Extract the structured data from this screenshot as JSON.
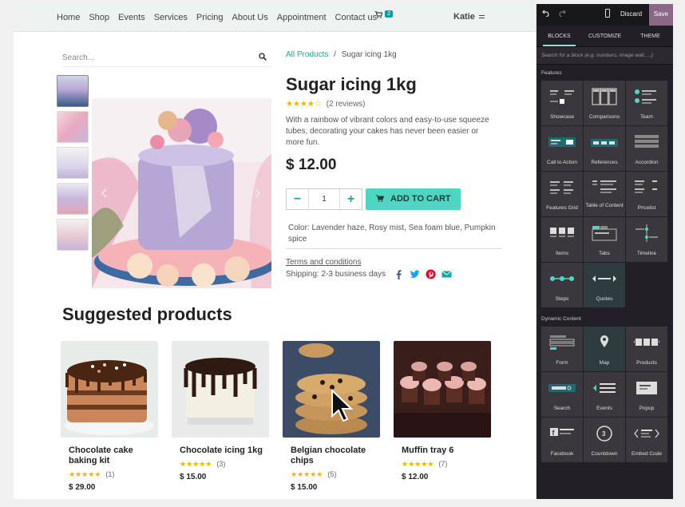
{
  "nav": {
    "links": [
      "Home",
      "Shop",
      "Events",
      "Services",
      "Pricing",
      "About Us",
      "Appointment",
      "Contact us"
    ],
    "cart_count": "2",
    "user": "Katie"
  },
  "search": {
    "placeholder": "Search..."
  },
  "breadcrumb": {
    "parent": "All Products",
    "separator": "/",
    "current": "Sugar icing 1kg"
  },
  "product": {
    "title": "Sugar icing 1kg",
    "stars": "★★★★☆",
    "reviews": "(2 reviews)",
    "description": "With a rainbow of vibrant colors and easy-to-use squeeze tubes, decorating your cakes has never been easier or more fun.",
    "price": "$ 12.00",
    "quantity": "1",
    "add_to_cart": "ADD TO CART",
    "colors": "Color: Lavender haze, Rosy mist, Sea foam blue, Pumpkin spice",
    "terms": "Terms and conditions",
    "shipping": "Shipping: 2-3 business days"
  },
  "suggested": {
    "heading": "Suggested products",
    "items": [
      {
        "name": "Chocolate cake baking kit",
        "stars": "★★★★★",
        "count": "(1)",
        "price": "$ 29.00"
      },
      {
        "name": "Chocolate icing 1kg",
        "stars": "★★★★★",
        "count": "(3)",
        "price": "$ 15.00"
      },
      {
        "name": "Belgian chocolate chips",
        "stars": "★★★★★",
        "count": "(5)",
        "price": "$ 15.00"
      },
      {
        "name": "Muffin tray 6",
        "stars": "★★★★★",
        "count": "(7)",
        "price": "$ 12.00"
      }
    ]
  },
  "editor": {
    "discard": "Discard",
    "save": "Save",
    "tabs": [
      "BLOCKS",
      "CUSTOMIZE",
      "THEME"
    ],
    "search_placeholder": "Search for a block (e.g. numbers, image wall, ...)",
    "features_title": "Features",
    "features": [
      "Showcase",
      "Comparisons",
      "Team",
      "Call to Action",
      "References",
      "Accordion",
      "Features Grid",
      "Table of Content",
      "Pricelist",
      "Items",
      "Tabs",
      "Timeline",
      "Steps",
      "Quotes"
    ],
    "dynamic_title": "Dynamic Content",
    "dynamic": [
      "Form",
      "Map",
      "Products",
      "Search",
      "Events",
      "Popup",
      "Facebook",
      "Countdown",
      "Embed Code"
    ]
  },
  "colors": {
    "accent": "#4fd6c3",
    "link": "#1aa79b",
    "save": "#8a6886",
    "panel": "#222026",
    "star": "#f3b300"
  }
}
